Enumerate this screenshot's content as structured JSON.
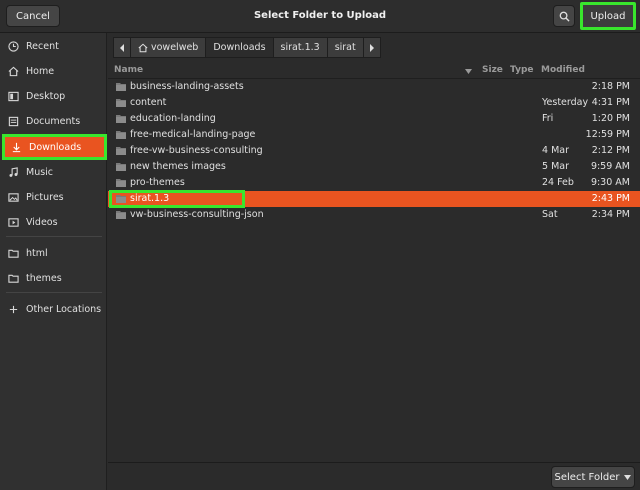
{
  "header": {
    "cancel_label": "Cancel",
    "title": "Select Folder to Upload",
    "upload_label": "Upload"
  },
  "sidebar": {
    "items": [
      {
        "label": "Recent",
        "icon": "clock-icon"
      },
      {
        "label": "Home",
        "icon": "home-icon"
      },
      {
        "label": "Desktop",
        "icon": "desktop-icon"
      },
      {
        "label": "Documents",
        "icon": "documents-icon"
      },
      {
        "label": "Downloads",
        "icon": "download-icon",
        "active": true
      },
      {
        "label": "Music",
        "icon": "music-icon"
      },
      {
        "label": "Pictures",
        "icon": "pictures-icon"
      },
      {
        "label": "Videos",
        "icon": "videos-icon"
      },
      {
        "label": "html",
        "icon": "folder-icon"
      },
      {
        "label": "themes",
        "icon": "folder-icon"
      },
      {
        "label": "Other Locations",
        "icon": "plus-icon"
      }
    ]
  },
  "pathbar": {
    "crumbs": [
      "vowelweb",
      "Downloads",
      "sirat.1.3",
      "sirat"
    ],
    "current": "Downloads"
  },
  "columns": {
    "name": "Name",
    "size": "Size",
    "type": "Type",
    "modified": "Modified"
  },
  "files": [
    {
      "name": "business-landing-assets",
      "date": "",
      "time": "2:18 PM"
    },
    {
      "name": "content",
      "date": "Yesterday",
      "time": "4:31 PM"
    },
    {
      "name": "education-landing",
      "date": "Fri",
      "time": "1:20 PM"
    },
    {
      "name": "free-medical-landing-page",
      "date": "",
      "time": "12:59 PM"
    },
    {
      "name": "free-vw-business-consulting",
      "date": "4 Mar",
      "time": "2:12 PM"
    },
    {
      "name": "new themes images",
      "date": "5 Mar",
      "time": "9:59 AM"
    },
    {
      "name": "pro-themes",
      "date": "24 Feb",
      "time": "9:30 AM"
    },
    {
      "name": "sirat.1.3",
      "date": "",
      "time": "2:43 PM",
      "selected": true
    },
    {
      "name": "vw-business-consulting-json",
      "date": "Sat",
      "time": "2:34 PM"
    }
  ],
  "footer": {
    "select_label": "Select Folder"
  },
  "colors": {
    "accent": "#e95420",
    "highlight": "#39e62d",
    "folder": "#7a7a7a"
  }
}
